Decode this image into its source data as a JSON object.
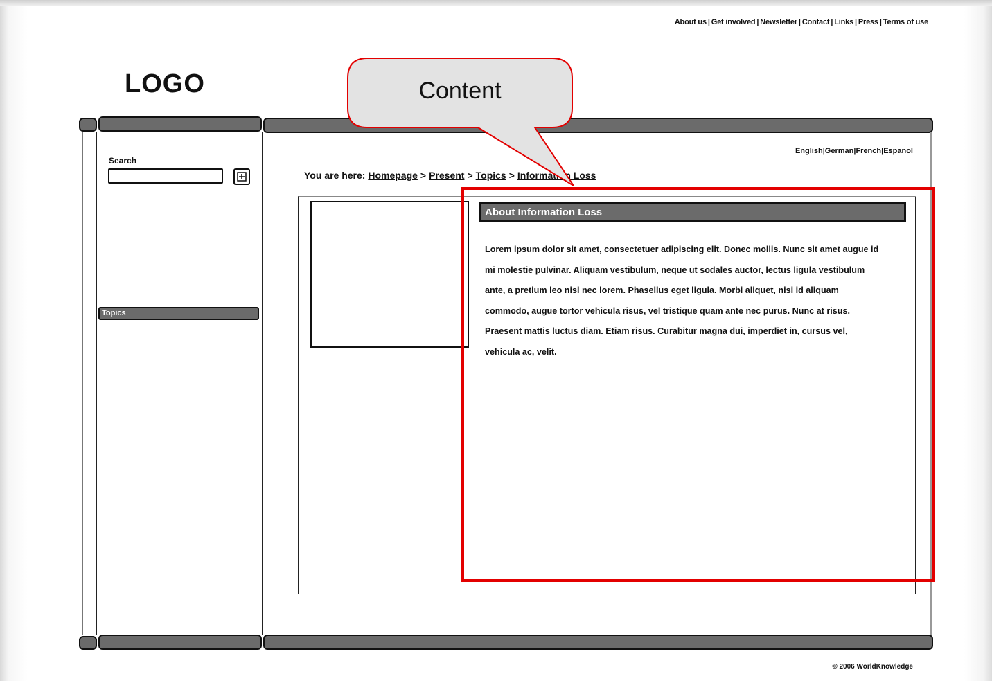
{
  "header": {
    "top_links": [
      "About us",
      "Get involved",
      "Newsletter",
      "Contact",
      "Links",
      "Press",
      "Terms of use"
    ],
    "logo": "LOGO"
  },
  "sidebar": {
    "search_label": "Search",
    "search_value": "",
    "topics_label": "Topics"
  },
  "main": {
    "languages": [
      "English",
      "German",
      "French",
      "Espanol"
    ],
    "breadcrumb": {
      "prefix": "You are here:",
      "items": [
        "Homepage",
        "Present",
        "Topics",
        "Information Loss"
      ]
    },
    "article_title": "About Information Loss",
    "article_body": "Lorem ipsum dolor sit amet, consectetuer adipiscing elit. Donec mollis. Nunc sit amet augue id mi molestie pulvinar. Aliquam vestibulum, neque ut sodales auctor, lectus ligula vestibulum ante, a pretium leo nisl nec lorem. Phasellus eget ligula. Morbi aliquet, nisi id aliquam commodo, augue tortor vehicula risus, vel tristique quam ante nec purus. Nunc at risus. Praesent mattis luctus diam. Etiam risus. Curabitur magna dui, imperdiet in, cursus vel, vehicula ac, velit."
  },
  "annotation": {
    "callout_label": "Content",
    "highlight_color": "#e30000",
    "callout_fill": "#e3e3e3"
  },
  "footer": {
    "copyright": "© 2006 WorldKnowledge"
  },
  "colors": {
    "bar_fill": "#6b6b6b",
    "outline": "#111111"
  }
}
